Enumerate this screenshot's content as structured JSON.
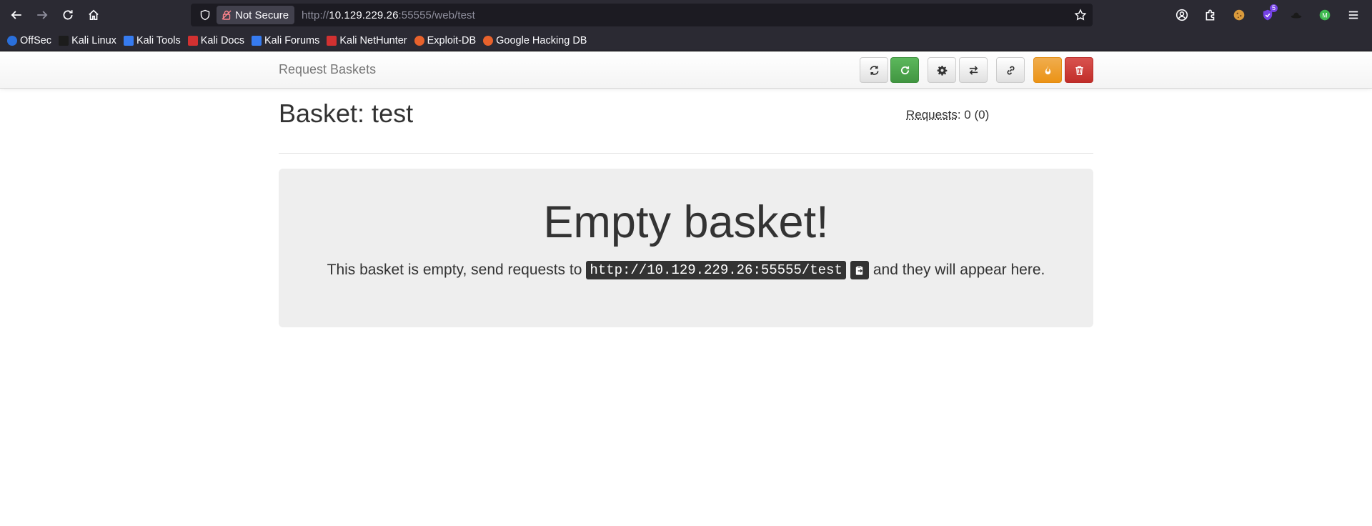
{
  "browser": {
    "security_label": "Not Secure",
    "url_prefix": "http://",
    "url_host": "10.129.229.26",
    "url_suffix": ":55555/web/test",
    "extensions_badge": "5",
    "bookmarks": [
      {
        "label": "OffSec",
        "color": "#2a6fdb"
      },
      {
        "label": "Kali Linux",
        "color": "#1c1c1c"
      },
      {
        "label": "Kali Tools",
        "color": "#367bf0"
      },
      {
        "label": "Kali Docs",
        "color": "#d23131"
      },
      {
        "label": "Kali Forums",
        "color": "#367bf0"
      },
      {
        "label": "Kali NetHunter",
        "color": "#d23131"
      },
      {
        "label": "Exploit-DB",
        "color": "#e8622c"
      },
      {
        "label": "Google Hacking DB",
        "color": "#e8622c"
      }
    ]
  },
  "navbar": {
    "brand": "Request Baskets"
  },
  "basket": {
    "title": "Basket: test",
    "requests_label": "Requests",
    "requests_count": ": 0 (0)"
  },
  "empty": {
    "heading": "Empty basket!",
    "text_before": "This basket is empty, send requests to",
    "basket_url": "http://10.129.229.26:55555/test",
    "text_after": "and they will appear here."
  },
  "colors": {
    "green": "#5cb85c",
    "orange": "#f0ad4e",
    "red": "#d9534f"
  }
}
